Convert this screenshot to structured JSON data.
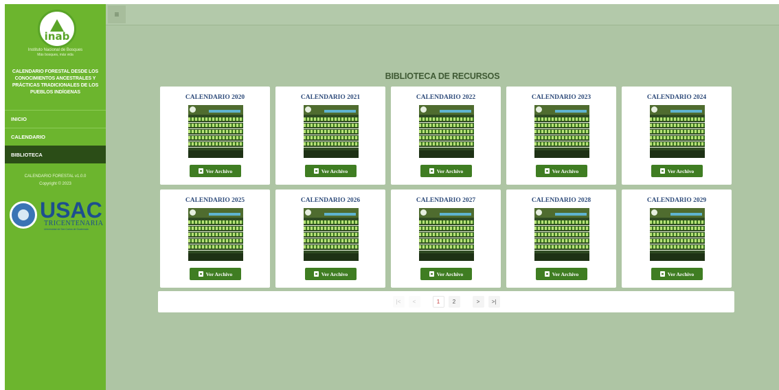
{
  "sidebar": {
    "logo_word": "inab",
    "institution": "Instituto Nacional de Bosques",
    "tagline": "Más bosques, más vida",
    "app_title": "CALENDARIO FORESTAL DESDE LOS CONOCIMIENTOS ANCESTRALES Y PRÁCTICAS TRADICIONALES DE LOS PUEBLOS INDÍGENAS",
    "nav": [
      {
        "label": "INICIO"
      },
      {
        "label": "CALENDARIO"
      },
      {
        "label": "BIBLIOTECA",
        "active": true
      }
    ],
    "version": "CALENDARIO FORESTAL v1.0.0",
    "copyright": "Copyright © 2023",
    "usac_text": "USAC",
    "usac_tri": "TRICENTENARIA",
    "usac_univ": "Universidad de San Carlos de Guatemala"
  },
  "topbar": {
    "menu_icon": "hamburger-icon"
  },
  "main": {
    "title": "BIBLIOTECA DE RECURSOS",
    "button_label": "Ver Archivo",
    "cards": [
      {
        "title": "CALENDARIO 2020"
      },
      {
        "title": "CALENDARIO 2021"
      },
      {
        "title": "CALENDARIO 2022"
      },
      {
        "title": "CALENDARIO 2023"
      },
      {
        "title": "CALENDARIO 2024"
      },
      {
        "title": "CALENDARIO 2025"
      },
      {
        "title": "CALENDARIO 2026"
      },
      {
        "title": "CALENDARIO 2027"
      },
      {
        "title": "CALENDARIO 2028"
      },
      {
        "title": "CALENDARIO 2029"
      }
    ]
  },
  "pagination": {
    "first": "|<",
    "prev": "<",
    "pages": [
      "1",
      "2"
    ],
    "current": "1",
    "next": ">",
    "last": ">|"
  },
  "colors": {
    "sidebar": "#6cb52e",
    "sidebar_active": "#2b4d17",
    "main_bg": "#aec5a4",
    "button": "#3f7d22",
    "card_title": "#2e4b7a"
  }
}
